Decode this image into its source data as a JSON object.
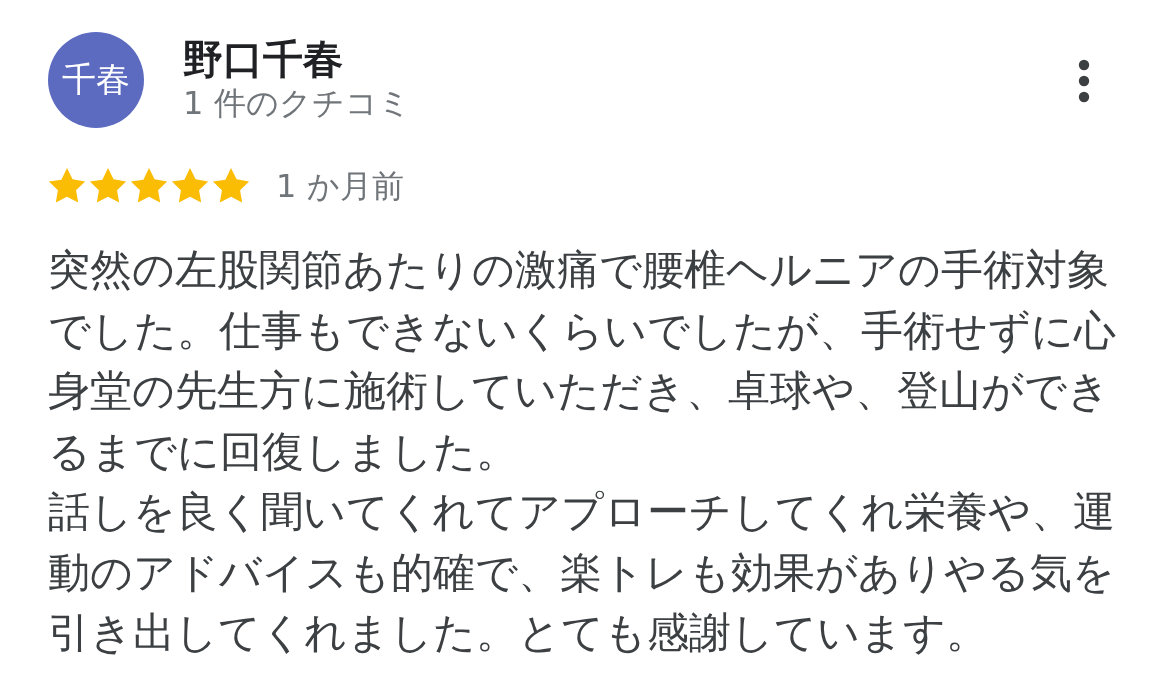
{
  "reviewer": {
    "avatar_initials": "千春",
    "name": "野口千春",
    "review_count": "1 件のクチコミ"
  },
  "review": {
    "stars": 5,
    "time": "1 か月前",
    "paragraphs": [
      "突然の左股関節あたりの激痛で腰椎ヘルニアの手術対象でした。仕事もできないくらいでしたが、手術せずに心身堂の先生方に施術していただき、卓球や、登山ができるまでに回復しました。",
      "話しを良く聞いてくれてアプローチしてくれ栄養や、運動のアドバイスも的確で、楽トレも効果がありやる気を引き出してくれました。とても感謝しています。"
    ]
  }
}
